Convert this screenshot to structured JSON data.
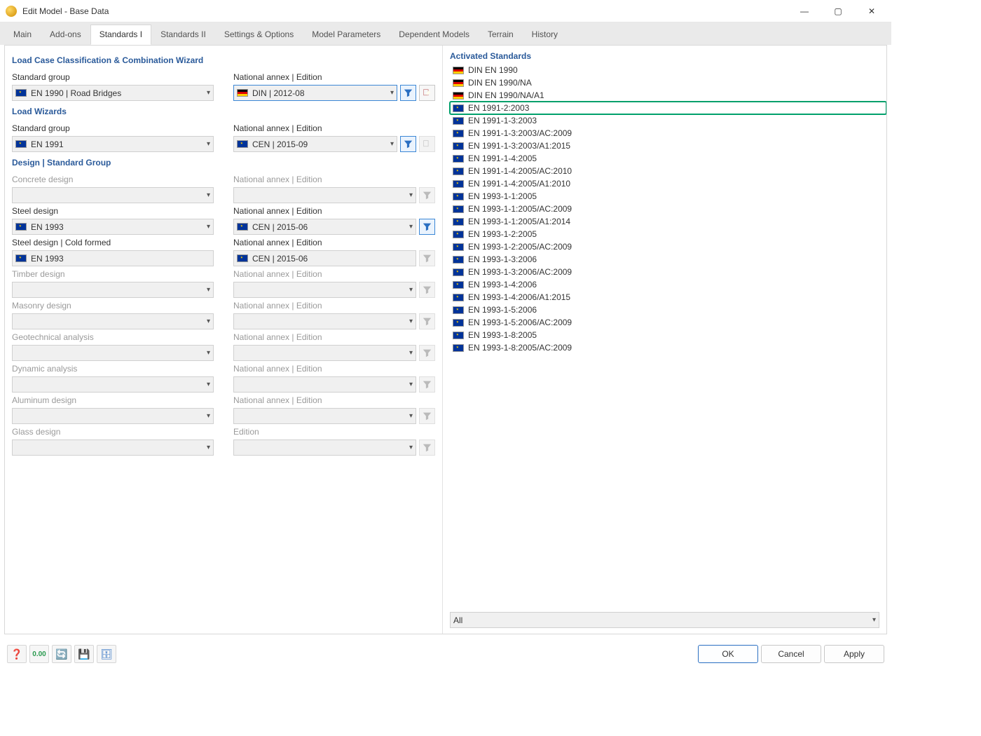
{
  "window": {
    "title": "Edit Model - Base Data"
  },
  "tabs": [
    "Main",
    "Add-ons",
    "Standards I",
    "Standards II",
    "Settings & Options",
    "Model Parameters",
    "Dependent Models",
    "Terrain",
    "History"
  ],
  "active_tab": 2,
  "sections": {
    "classification": {
      "title": "Load Case Classification & Combination Wizard",
      "standard_group": {
        "label": "Standard group",
        "value": "EN 1990 | Road Bridges",
        "flag": "eu"
      },
      "annex": {
        "label": "National annex | Edition",
        "value": "DIN | 2012-08",
        "flag": "de"
      }
    },
    "wizards": {
      "title": "Load Wizards",
      "standard_group": {
        "label": "Standard group",
        "value": "EN 1991",
        "flag": "eu"
      },
      "annex": {
        "label": "National annex | Edition",
        "value": "CEN | 2015-09",
        "flag": "eu"
      }
    },
    "design": {
      "title": "Design | Standard Group",
      "rows": [
        {
          "name": "Concrete design",
          "std": "",
          "annex_label": "National annex | Edition",
          "annex": "",
          "enabled": false
        },
        {
          "name": "Steel design",
          "std": "EN 1993",
          "annex_label": "National annex | Edition",
          "annex": "CEN | 2015-06",
          "enabled": true
        },
        {
          "name": "Steel design | Cold formed",
          "std": "EN 1993",
          "annex_label": "National annex | Edition",
          "annex": "CEN | 2015-06",
          "enabled": true,
          "readonly": true
        },
        {
          "name": "Timber design",
          "std": "",
          "annex_label": "National annex | Edition",
          "annex": "",
          "enabled": false
        },
        {
          "name": "Masonry design",
          "std": "",
          "annex_label": "National annex | Edition",
          "annex": "",
          "enabled": false
        },
        {
          "name": "Geotechnical analysis",
          "std": "",
          "annex_label": "National annex | Edition",
          "annex": "",
          "enabled": false
        },
        {
          "name": "Dynamic analysis",
          "std": "",
          "annex_label": "National annex | Edition",
          "annex": "",
          "enabled": false
        },
        {
          "name": "Aluminum design",
          "std": "",
          "annex_label": "National annex | Edition",
          "annex": "",
          "enabled": false
        },
        {
          "name": "Glass design",
          "std": "",
          "annex_label": "Edition",
          "annex": "",
          "enabled": false
        }
      ]
    }
  },
  "activated": {
    "title": "Activated Standards",
    "items": [
      {
        "text": "DIN EN 1990",
        "flag": "de"
      },
      {
        "text": "DIN EN 1990/NA",
        "flag": "de"
      },
      {
        "text": "DIN EN 1990/NA/A1",
        "flag": "de"
      },
      {
        "text": "EN 1991-2:2003",
        "flag": "eu",
        "highlight": true
      },
      {
        "text": "EN 1991-1-3:2003",
        "flag": "eu"
      },
      {
        "text": "EN 1991-1-3:2003/AC:2009",
        "flag": "eu"
      },
      {
        "text": "EN 1991-1-3:2003/A1:2015",
        "flag": "eu"
      },
      {
        "text": "EN 1991-1-4:2005",
        "flag": "eu"
      },
      {
        "text": "EN 1991-1-4:2005/AC:2010",
        "flag": "eu"
      },
      {
        "text": "EN 1991-1-4:2005/A1:2010",
        "flag": "eu"
      },
      {
        "text": "EN 1993-1-1:2005",
        "flag": "eu"
      },
      {
        "text": "EN 1993-1-1:2005/AC:2009",
        "flag": "eu"
      },
      {
        "text": "EN 1993-1-1:2005/A1:2014",
        "flag": "eu"
      },
      {
        "text": "EN 1993-1-2:2005",
        "flag": "eu"
      },
      {
        "text": "EN 1993-1-2:2005/AC:2009",
        "flag": "eu"
      },
      {
        "text": "EN 1993-1-3:2006",
        "flag": "eu"
      },
      {
        "text": "EN 1993-1-3:2006/AC:2009",
        "flag": "eu"
      },
      {
        "text": "EN 1993-1-4:2006",
        "flag": "eu"
      },
      {
        "text": "EN 1993-1-4:2006/A1:2015",
        "flag": "eu"
      },
      {
        "text": "EN 1993-1-5:2006",
        "flag": "eu"
      },
      {
        "text": "EN 1993-1-5:2006/AC:2009",
        "flag": "eu"
      },
      {
        "text": "EN 1993-1-8:2005",
        "flag": "eu"
      },
      {
        "text": "EN 1993-1-8:2005/AC:2009",
        "flag": "eu"
      }
    ],
    "filter": "All"
  },
  "footer": {
    "ok": "OK",
    "cancel": "Cancel",
    "apply": "Apply"
  }
}
